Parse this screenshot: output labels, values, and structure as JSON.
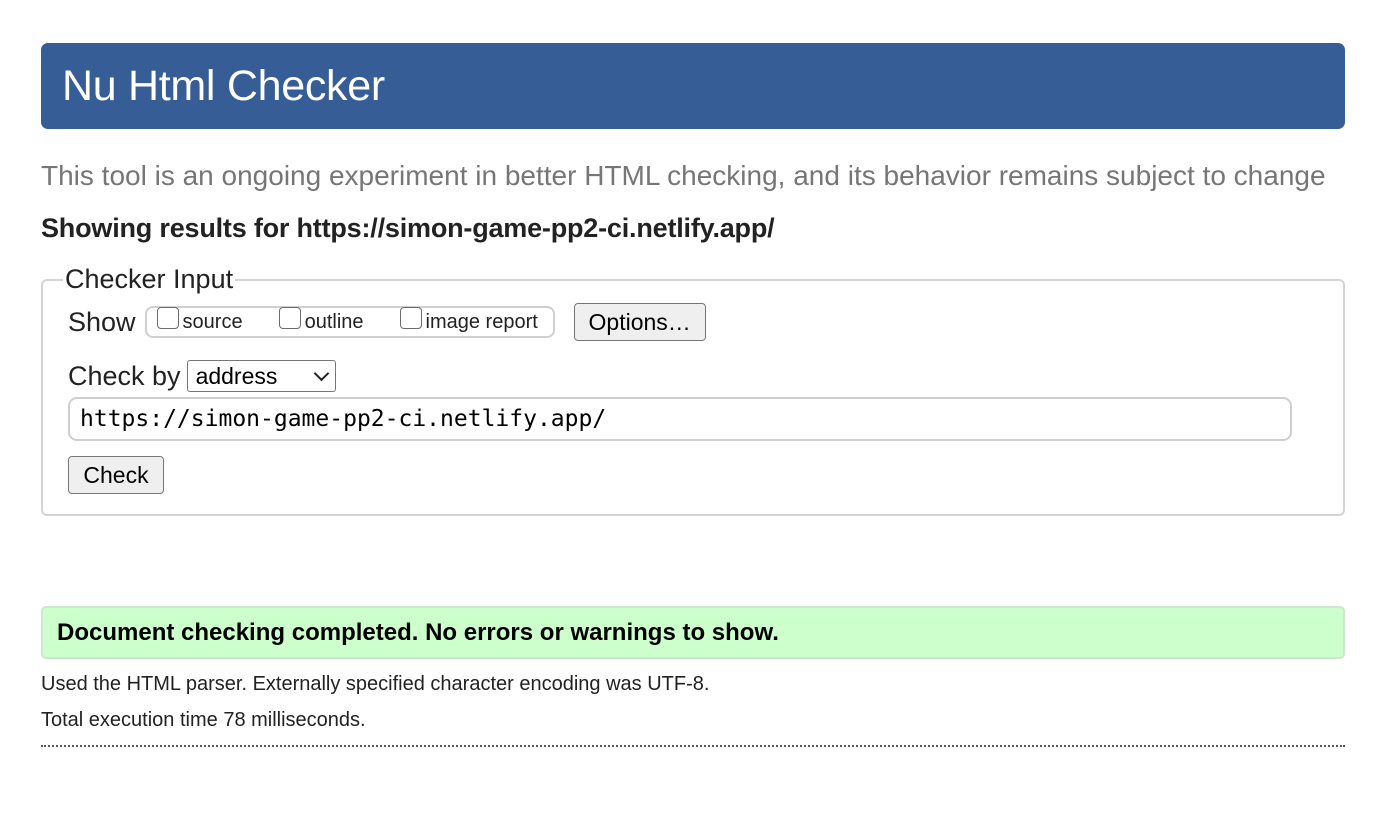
{
  "header": {
    "title": "Nu Html Checker"
  },
  "intro": {
    "text": "This tool is an ongoing experiment in better HTML checking, and its behavior remains subject to change"
  },
  "results_heading": "Showing results for https://simon-game-pp2-ci.netlify.app/",
  "checker_input": {
    "legend": "Checker Input",
    "show_label": "Show",
    "show_options": [
      {
        "label": "source",
        "checked": false
      },
      {
        "label": "outline",
        "checked": false
      },
      {
        "label": "image report",
        "checked": false
      }
    ],
    "options_button": "Options…",
    "check_by_label": "Check by",
    "check_by_selected": "address",
    "url_value": "https://simon-game-pp2-ci.netlify.app/",
    "check_button": "Check"
  },
  "result": {
    "message": "Document checking completed. No errors or warnings to show."
  },
  "details": {
    "parser_info": "Used the HTML parser. Externally specified character encoding was UTF-8.",
    "execution_time": "Total execution time 78 milliseconds."
  },
  "colors": {
    "header_bg": "#365d95",
    "success_bg": "#ccffcc",
    "intro_text": "#767676"
  }
}
